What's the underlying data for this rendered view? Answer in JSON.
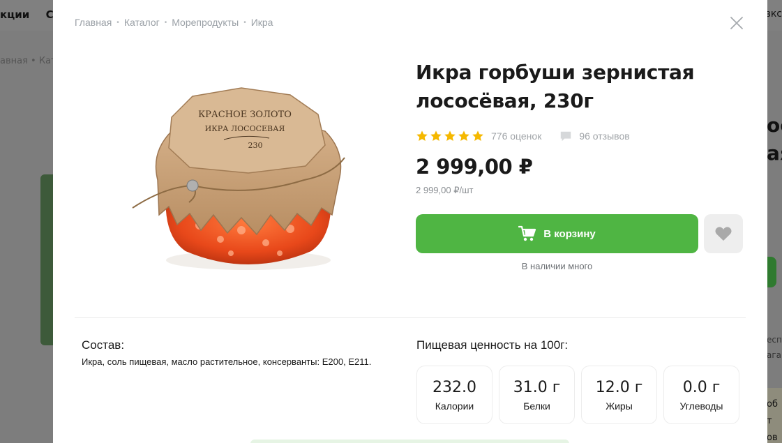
{
  "background": {
    "nav_left": [
      "кции",
      "Ск"
    ],
    "nav_right": "авкс",
    "breadcrumb": "авная • Катал",
    "right_title": "ос ая",
    "right_text": "есп ага",
    "right_card": "об т ов"
  },
  "breadcrumb": {
    "items": [
      "Главная",
      "Каталог",
      "Морепродукты",
      "Икра"
    ]
  },
  "product": {
    "title": "Икра горбуши зернистая лососёвая, 230г",
    "rating_count": "776 оценок",
    "reviews_count": "96 отзывов",
    "stars": 5,
    "price": "2 999,00 ₽",
    "unit_price": "2 999,00 ₽/шт",
    "add_to_cart": "В корзину",
    "stock": "В наличии много",
    "jar_brand": "КРАСНОЕ ЗОЛОТО",
    "jar_name": "ИКРА ЛОСОСЕВАЯ",
    "jar_weight": "230"
  },
  "composition": {
    "title": "Состав:",
    "text": "Икра, соль пищевая, масло растительное, консерванты: Е200, Е211."
  },
  "nutrition": {
    "title": "Пищевая ценность на 100г:",
    "items": [
      {
        "value": "232.0",
        "label": "Калории"
      },
      {
        "value": "31.0 г",
        "label": "Белки"
      },
      {
        "value": "12.0 г",
        "label": "Жиры"
      },
      {
        "value": "0.0 г",
        "label": "Углеводы"
      }
    ]
  },
  "colors": {
    "accent": "#4fb543",
    "star": "#f5b800",
    "overlay": "#7d7d7d"
  }
}
